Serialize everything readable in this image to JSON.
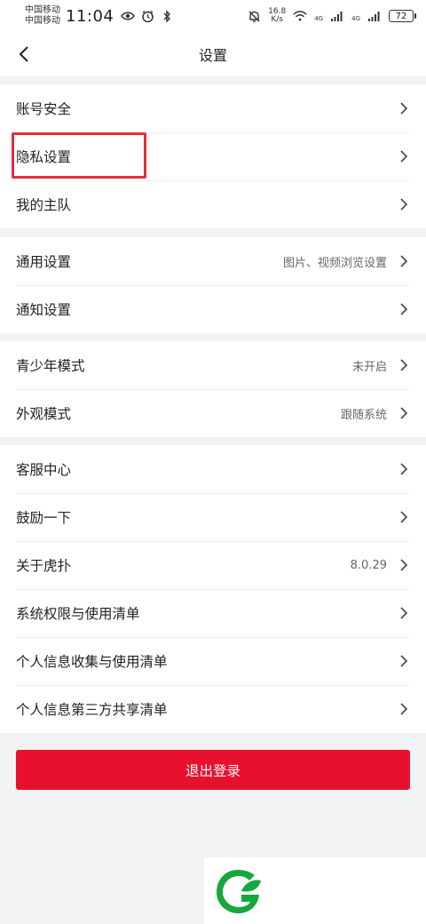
{
  "status_bar": {
    "carrier_1": "中国移动",
    "carrier_2": "中国移动",
    "time": "11:04",
    "speed_value": "16.8",
    "speed_unit": "K/s",
    "signal_1_label": "4G",
    "signal_2_label": "4G",
    "battery": "72"
  },
  "nav": {
    "title": "设置"
  },
  "groups": [
    {
      "items": [
        {
          "label": "账号安全"
        },
        {
          "label": "隐私设置"
        },
        {
          "label": "我的主队"
        }
      ]
    },
    {
      "items": [
        {
          "label": "通用设置",
          "value": "图片、视频浏览设置"
        },
        {
          "label": "通知设置"
        }
      ]
    },
    {
      "items": [
        {
          "label": "青少年模式",
          "value": "未开启"
        },
        {
          "label": "外观模式",
          "value": "跟随系统"
        }
      ]
    },
    {
      "items": [
        {
          "label": "客服中心"
        },
        {
          "label": "鼓励一下"
        },
        {
          "label": "关于虎扑",
          "value": "8.0.29"
        },
        {
          "label": "系统权限与使用清单"
        },
        {
          "label": "个人信息收集与使用清单"
        },
        {
          "label": "个人信息第三方共享清单"
        }
      ]
    }
  ],
  "logout_label": "退出登录",
  "colors": {
    "accent_red": "#e8112d",
    "highlight_red": "#e0303d",
    "logo_green": "#15a83c"
  }
}
